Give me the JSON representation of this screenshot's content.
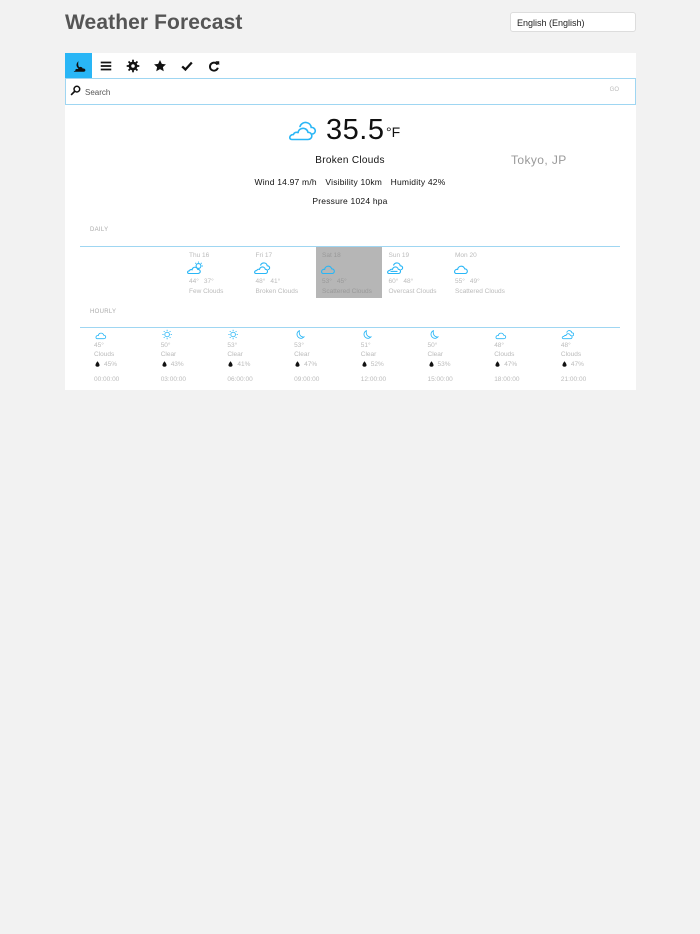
{
  "app": {
    "title": "Weather Forecast"
  },
  "language": {
    "selected": "English (English)"
  },
  "toolbar": {
    "buttons": [
      {
        "icon": "weather-icon",
        "active": true
      },
      {
        "icon": "menu-icon"
      },
      {
        "icon": "gear-icon"
      },
      {
        "icon": "star-icon"
      },
      {
        "icon": "check-icon"
      },
      {
        "icon": "refresh-icon"
      }
    ]
  },
  "search": {
    "placeholder": "Search",
    "go_label": "GO"
  },
  "current": {
    "icon": "broken-clouds-icon",
    "temperature": "35.5",
    "unit": "°F",
    "condition": "Broken Clouds",
    "location": "Tokyo, JP",
    "wind": "Wind 14.97 m/h",
    "visibility": "Visibility 10km",
    "humidity": "Humidity 42%",
    "pressure": "Pressure 1024 hpa"
  },
  "daily": {
    "label": "DAILY",
    "days": [
      {
        "day": "Thu 16",
        "high": "44°",
        "low": "37°",
        "desc": "Few Clouds",
        "icon": "few-clouds-icon",
        "selected": false
      },
      {
        "day": "Fri 17",
        "high": "48°",
        "low": "41°",
        "desc": "Broken Clouds",
        "icon": "broken-clouds-icon",
        "selected": false
      },
      {
        "day": "Sat 18",
        "high": "53°",
        "low": "45°",
        "desc": "Scattered Clouds",
        "icon": "scattered-clouds-icon",
        "selected": true
      },
      {
        "day": "Sun 19",
        "high": "60°",
        "low": "48°",
        "desc": "Overcast Clouds",
        "icon": "overcast-clouds-icon",
        "selected": false
      },
      {
        "day": "Mon 20",
        "high": "55°",
        "low": "49°",
        "desc": "Scattered Clouds",
        "icon": "scattered-clouds-icon",
        "selected": false
      }
    ]
  },
  "hourly": {
    "label": "HOURLY",
    "hours": [
      {
        "temp": "45°",
        "desc": "Clouds",
        "humidity": "45%",
        "time": "00:00:00",
        "icon": "cloud-icon"
      },
      {
        "temp": "50°",
        "desc": "Clear",
        "humidity": "43%",
        "time": "03:00:00",
        "icon": "sun-icon"
      },
      {
        "temp": "53°",
        "desc": "Clear",
        "humidity": "41%",
        "time": "06:00:00",
        "icon": "sun-icon"
      },
      {
        "temp": "53°",
        "desc": "Clear",
        "humidity": "47%",
        "time": "09:00:00",
        "icon": "moon-icon"
      },
      {
        "temp": "51°",
        "desc": "Clear",
        "humidity": "52%",
        "time": "12:00:00",
        "icon": "moon-icon"
      },
      {
        "temp": "50°",
        "desc": "Clear",
        "humidity": "53%",
        "time": "15:00:00",
        "icon": "moon-icon"
      },
      {
        "temp": "48°",
        "desc": "Clouds",
        "humidity": "47%",
        "time": "18:00:00",
        "icon": "cloud-icon"
      },
      {
        "temp": "48°",
        "desc": "Clouds",
        "humidity": "47%",
        "time": "21:00:00",
        "icon": "broken-clouds-icon"
      }
    ]
  },
  "colors": {
    "accent": "#29b6f6",
    "selected_day": "#b6b6b6",
    "rule": "#9fd6f2",
    "muted": "#bbbbbb"
  }
}
